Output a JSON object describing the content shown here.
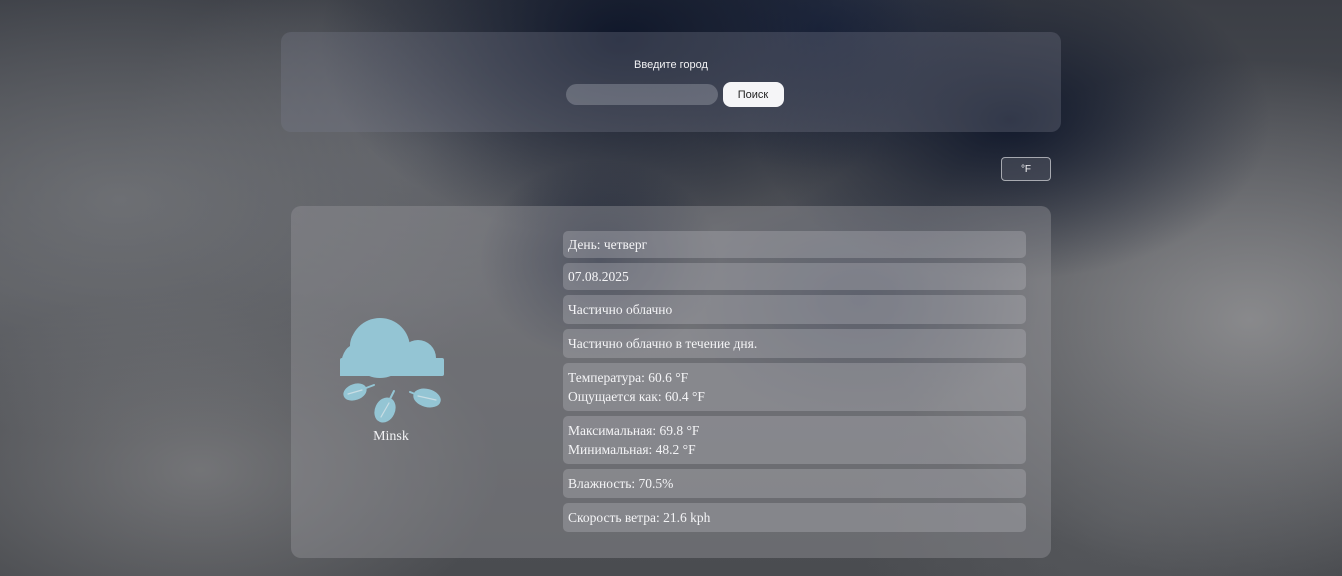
{
  "search": {
    "label": "Введите город",
    "input_value": "",
    "button_label": "Поиск"
  },
  "unit_toggle": {
    "label": "°F"
  },
  "weather": {
    "icon": "cloud-rain-icon",
    "icon_color": "#94c5d4",
    "city": "Minsk",
    "day": "День: четверг",
    "date": "07.08.2025",
    "condition": "Частично облачно",
    "description": "Частично облачно в течение дня.",
    "temperature": "Температура: 60.6 °F",
    "feels_like": "Ощущается как: 60.4 °F",
    "max_temp": "Максимальная: 69.8 °F",
    "min_temp": "Минимальная: 48.2 °F",
    "humidity": "Влажность: 70.5%",
    "wind_speed": "Скорость ветра: 21.6 kph"
  }
}
